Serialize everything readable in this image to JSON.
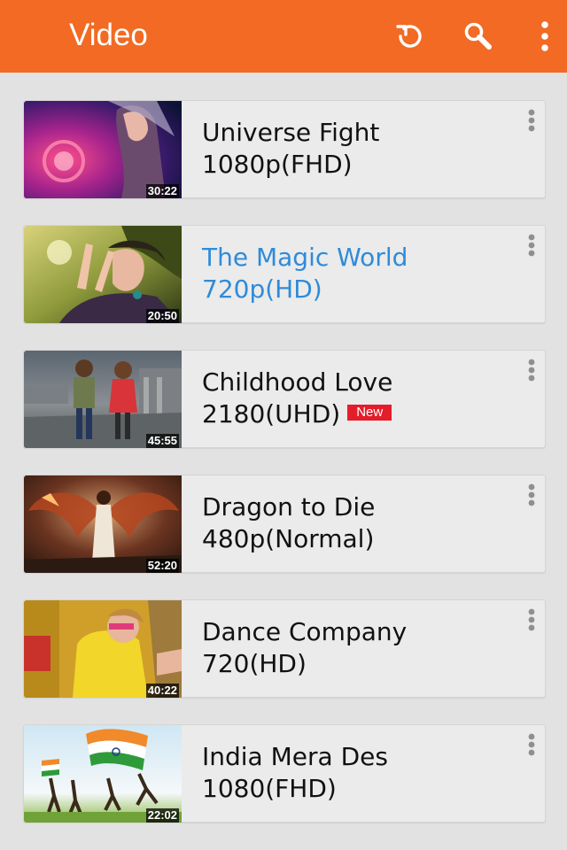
{
  "header": {
    "title": "Video",
    "background": "#f26a23",
    "actions": [
      "refresh-icon",
      "search-icon",
      "more-vertical-icon"
    ]
  },
  "videos": [
    {
      "title": "Universe Fight",
      "quality": "1080p(FHD)",
      "duration": "30:22",
      "badge": "",
      "active": false
    },
    {
      "title": "The Magic World",
      "quality": "720p(HD)",
      "duration": "20:50",
      "badge": "",
      "active": true
    },
    {
      "title": "Childhood Love",
      "quality": "2180(UHD)",
      "duration": "45:55",
      "badge": "New",
      "active": false
    },
    {
      "title": "Dragon to Die",
      "quality": "480p(Normal)",
      "duration": "52:20",
      "badge": "",
      "active": false
    },
    {
      "title": "Dance Company",
      "quality": "720(HD)",
      "duration": "40:22",
      "badge": "",
      "active": false
    },
    {
      "title": "India Mera Des",
      "quality": "1080(FHD)",
      "duration": "22:02",
      "badge": "",
      "active": false
    }
  ],
  "colors": {
    "accent": "#f26a23",
    "active_text": "#2f8bd9",
    "badge": "#e31d29"
  }
}
